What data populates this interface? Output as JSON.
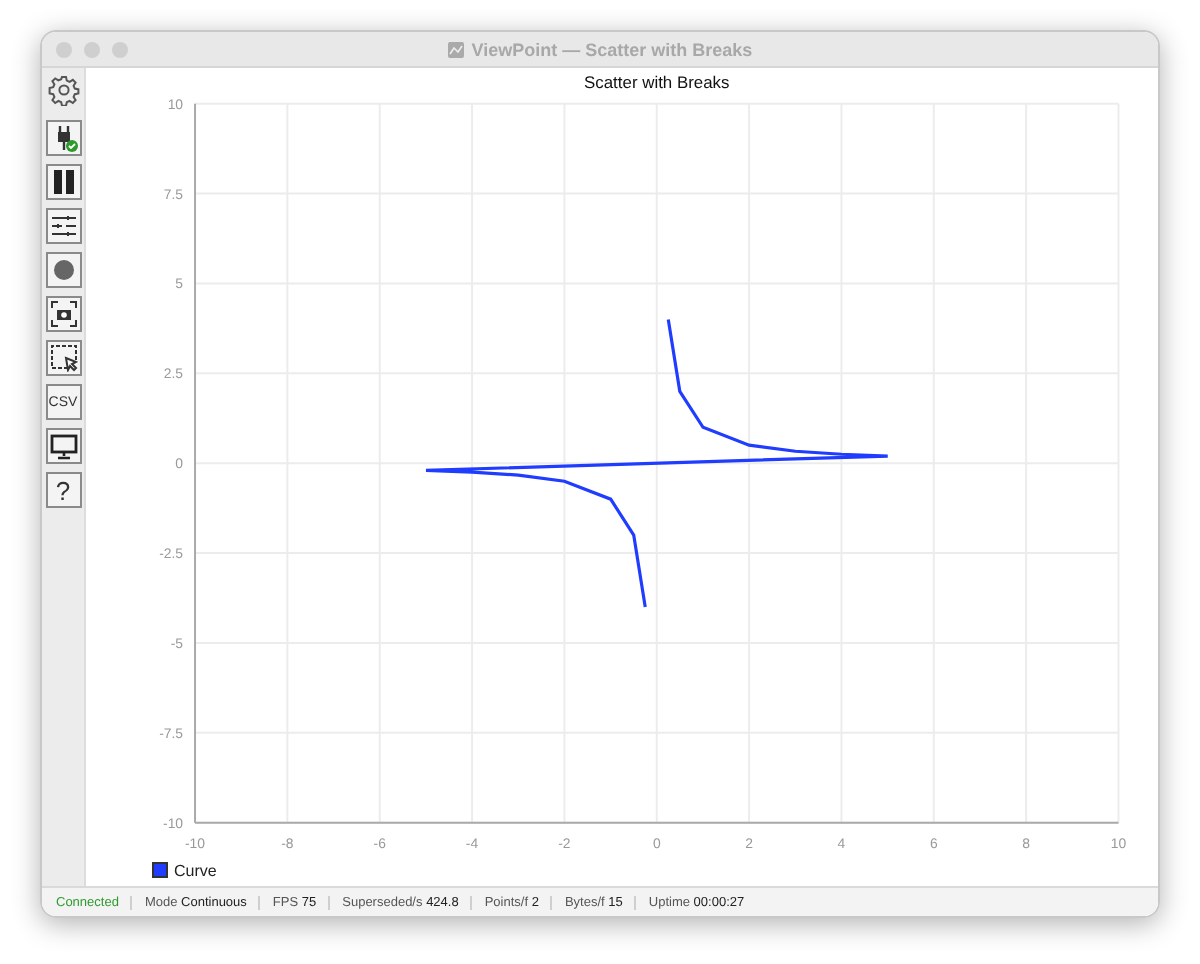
{
  "window": {
    "title": "ViewPoint — Scatter with Breaks"
  },
  "toolbar": {
    "csv_label": "CSV",
    "help_label": "?"
  },
  "chart": {
    "chart_data": {
      "type": "line",
      "title": "Scatter with Breaks",
      "x": [
        0.25,
        0.5,
        1,
        2,
        3,
        4,
        5,
        -5,
        -4,
        -3,
        -2,
        -1,
        -0.5,
        -0.25
      ],
      "series": [
        {
          "name": "Curve",
          "color": "#1f3cff",
          "values": [
            4,
            2,
            1,
            0.5,
            0.33,
            0.25,
            0.2,
            -0.2,
            -0.25,
            -0.33,
            -0.5,
            -1,
            -2,
            -4
          ]
        }
      ],
      "grid": true,
      "xlim": [
        -10,
        10
      ],
      "ylim": [
        -10,
        10
      ],
      "xticks": [
        -10,
        -8,
        -6,
        -4,
        -2,
        0,
        2,
        4,
        6,
        8,
        10
      ],
      "yticks": [
        -10,
        -7.5,
        -5,
        -2.5,
        0,
        2.5,
        5,
        7.5,
        10
      ]
    }
  },
  "status_bar": {
    "connection": "Connected",
    "items": [
      {
        "label": "Mode",
        "value": "Continuous"
      },
      {
        "label": "FPS",
        "value": "75"
      },
      {
        "label": "Superseded/s",
        "value": "424.8"
      },
      {
        "label": "Points/f",
        "value": "2"
      },
      {
        "label": "Bytes/f",
        "value": "15"
      },
      {
        "label": "Uptime",
        "value": "00:00:27"
      }
    ]
  }
}
